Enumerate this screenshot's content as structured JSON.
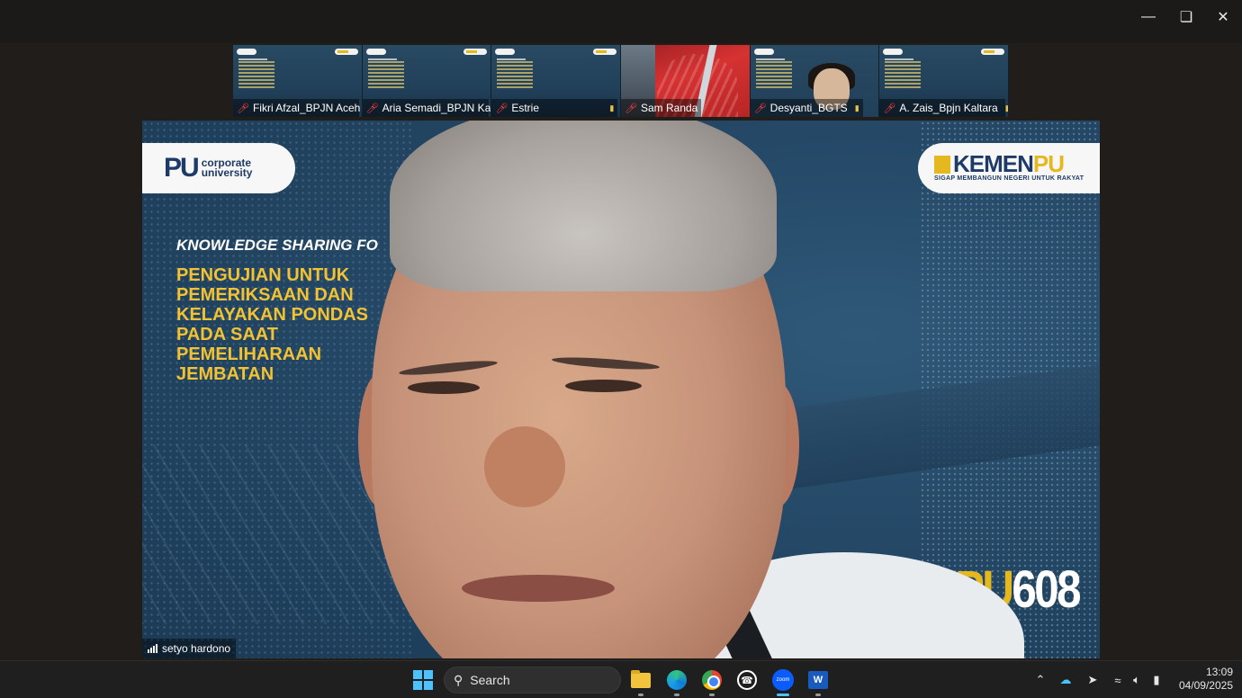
{
  "window": {
    "minimize_icon": "minimize-icon",
    "restore_icon": "restore-icon",
    "close_icon": "close-icon"
  },
  "participants": [
    {
      "name": "Fikri Afzal_BPJN Aceh",
      "muted": true,
      "kind": "slide"
    },
    {
      "name": "Aria Semadi_BPJN Kal...",
      "muted": true,
      "kind": "slide"
    },
    {
      "name": "Estrie",
      "muted": true,
      "kind": "slide"
    },
    {
      "name": "Sam Randa",
      "muted": true,
      "kind": "camera-scene"
    },
    {
      "name": "Desyanti_BGTS",
      "muted": true,
      "kind": "camera"
    },
    {
      "name": "A. Zais_Bpjn Kaltara",
      "muted": true,
      "kind": "slide"
    }
  ],
  "slide": {
    "logo_left": {
      "pu": "PU",
      "text_line1": "corporate",
      "text_line2": "university"
    },
    "logo_right": {
      "brand_a": "KEMEN",
      "brand_b": "PU",
      "tagline": "SIGAP MEMBANGUN NEGERI UNTUK RAKYAT"
    },
    "title": "KNOWLEDGE SHARING FO",
    "subtitle": "PENGUJIAN UNTUK\nPEMERIKSAAN DAN\nKELAYAKAN PONDAS\nPADA SAAT\nPEMELIHARAAN\nJEMBATAN",
    "badge_a": "PU",
    "badge_b": "608"
  },
  "speaker": {
    "name": "setyo hardono"
  },
  "taskbar": {
    "search_label": "Search",
    "apps": [
      "start-icon",
      "file-explorer-icon",
      "edge-icon",
      "chrome-icon",
      "whatsapp-icon",
      "zoom-icon",
      "word-icon"
    ],
    "active_app": "zoom-icon",
    "tray": [
      "chevron-up-icon",
      "onedrive-icon",
      "location-icon",
      "wifi-icon",
      "volume-icon",
      "battery-icon"
    ],
    "time": "13:09",
    "date": "04/09/2025"
  },
  "colors": {
    "accent": "#e5b820",
    "slide_blue": "#1d3b66",
    "taskbar": "#1f1f1f",
    "mic_off": "#ff4040"
  }
}
